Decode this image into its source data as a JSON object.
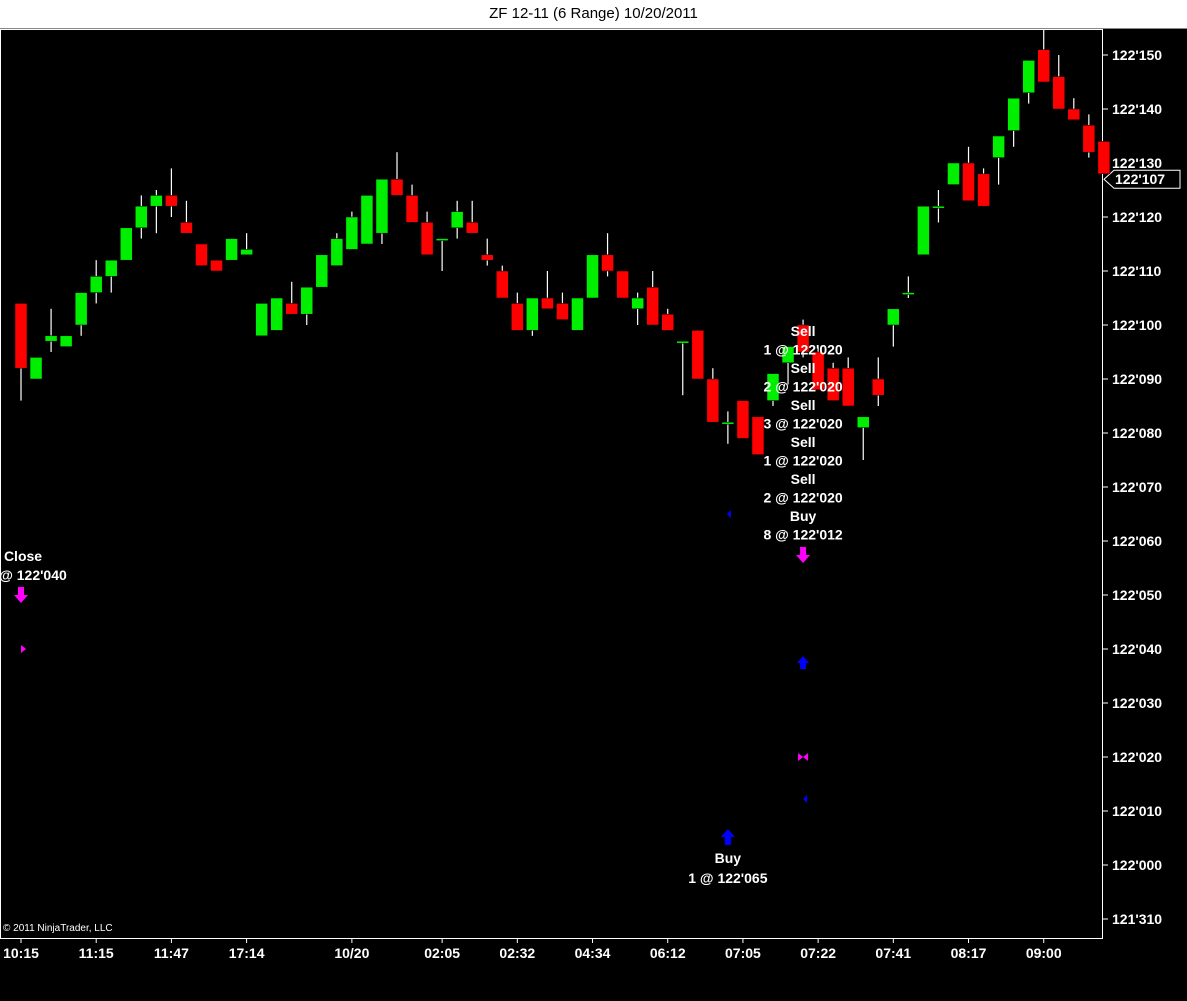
{
  "window": {
    "title": "ZF 12-11 (6 Range)  10/20/2011"
  },
  "copyright": "© 2011 NinjaTrader, LLC",
  "colors": {
    "background": "#000000",
    "up": "#00ee00",
    "down": "#ff0000",
    "wick": "#ffffff",
    "entry_marker": "#0000ff",
    "exit_marker": "#ff00ff"
  },
  "chart_data": {
    "type": "candlestick",
    "instrument": "ZF 12-11",
    "bar_type": "6 Range",
    "date": "10/20/2011",
    "price_unit": "32nds (fractional quote)",
    "y_ticks": [
      "122'150",
      "122'140",
      "122'130",
      "122'120",
      "122'110",
      "122'100",
      "122'090",
      "122'080",
      "122'070",
      "122'060",
      "122'050",
      "122'040",
      "122'030",
      "122'020",
      "122'010",
      "122'000",
      "121'310"
    ],
    "y_range_quarter32": [
      121.31,
      122.15
    ],
    "last_price_label": "122'107",
    "last_price": 122.107,
    "x_ticks": [
      {
        "label": "10:15",
        "bar": 0
      },
      {
        "label": "11:15",
        "bar": 5
      },
      {
        "label": "11:47",
        "bar": 10
      },
      {
        "label": "17:14",
        "bar": 15
      },
      {
        "label": "10/20",
        "bar": 22
      },
      {
        "label": "02:05",
        "bar": 28
      },
      {
        "label": "02:32",
        "bar": 33
      },
      {
        "label": "04:34",
        "bar": 38
      },
      {
        "label": "06:12",
        "bar": 43
      },
      {
        "label": "07:05",
        "bar": 48
      },
      {
        "label": "07:22",
        "bar": 53
      },
      {
        "label": "07:41",
        "bar": 58
      },
      {
        "label": "08:17",
        "bar": 63
      },
      {
        "label": "09:00",
        "bar": 68
      }
    ],
    "ohlc_32nds": [
      [
        3984,
        3984,
        3966,
        3972
      ],
      [
        3970,
        3974,
        3970,
        3974
      ],
      [
        3977,
        3983,
        3975,
        3978
      ],
      [
        3976,
        3978,
        3976,
        3978
      ],
      [
        3980,
        3986,
        3978,
        3986
      ],
      [
        3986,
        3992,
        3984,
        3989
      ],
      [
        3989,
        3992,
        3986,
        3992
      ],
      [
        3992,
        3998,
        3992,
        3998
      ],
      [
        3998,
        4004,
        3996,
        4002
      ],
      [
        4002,
        4005,
        3997,
        4004
      ],
      [
        4004,
        4009,
        4000,
        4002
      ],
      [
        3999,
        4003,
        3997,
        3997
      ],
      [
        3995,
        3995,
        3991,
        3991
      ],
      [
        3992,
        3992,
        3990,
        3990
      ],
      [
        3992,
        3996,
        3992,
        3996
      ],
      [
        3993,
        3997,
        3993,
        3994
      ],
      [
        3978,
        3984,
        3978,
        3984
      ],
      [
        3979,
        3985,
        3979,
        3985
      ],
      [
        3984,
        3988,
        3982,
        3982
      ],
      [
        3982,
        3987,
        3980,
        3987
      ],
      [
        3987,
        3993,
        3987,
        3993
      ],
      [
        3991,
        3997,
        3991,
        3996
      ],
      [
        3994,
        4001,
        3994,
        4000
      ],
      [
        3995,
        4002,
        3995,
        4004
      ],
      [
        3997,
        4007,
        3995,
        4007
      ],
      [
        4007,
        4012,
        4004,
        4004
      ],
      [
        4004,
        4006,
        3999,
        3999
      ],
      [
        3999,
        4001,
        3995,
        3993
      ],
      [
        3996,
        3996,
        3990,
        3996
      ],
      [
        3998,
        4003,
        3996,
        4001
      ],
      [
        3999,
        4003,
        3997,
        3997
      ],
      [
        3993,
        3996,
        3991,
        3992
      ],
      [
        3990,
        3991,
        3985,
        3985
      ],
      [
        3984,
        3986,
        3980,
        3979
      ],
      [
        3979,
        3982,
        3978,
        3985
      ],
      [
        3985,
        3990,
        3983,
        3983
      ],
      [
        3984,
        3986,
        3982,
        3981
      ],
      [
        3979,
        3985,
        3979,
        3985
      ],
      [
        3985,
        3993,
        3985,
        3993
      ],
      [
        3993,
        3997,
        3989,
        3990
      ],
      [
        3990,
        3990,
        3985,
        3985
      ],
      [
        3983,
        3986,
        3980,
        3985
      ],
      [
        3987,
        3990,
        3981,
        3980
      ],
      [
        3982,
        3983,
        3979,
        3979
      ],
      [
        3977,
        3977,
        3967,
        3977
      ],
      [
        3979,
        3979,
        3970,
        3970
      ],
      [
        3970,
        3972,
        3962,
        3962
      ],
      [
        3962,
        3964,
        3958,
        3962
      ],
      [
        3966,
        3966,
        3963,
        3959
      ],
      [
        3963,
        3963,
        3956,
        3956
      ],
      [
        3966,
        3971,
        3965,
        3971
      ],
      [
        3973,
        3976,
        3969,
        3976
      ],
      [
        3980,
        3981,
        3974,
        3975
      ],
      [
        3975,
        3976,
        3968,
        3968
      ],
      [
        3972,
        3973,
        3966,
        3966
      ],
      [
        3972,
        3974,
        3965,
        3965
      ],
      [
        3961,
        3963,
        3955,
        3963
      ],
      [
        3970,
        3974,
        3965,
        3967
      ],
      [
        3980,
        3983,
        3976,
        3983
      ],
      [
        3986,
        3989,
        3985,
        3986
      ],
      [
        3993,
        4002,
        3993,
        4002
      ],
      [
        4002,
        4005,
        3999,
        4002
      ],
      [
        4006,
        4010,
        4006,
        4010
      ],
      [
        4010,
        4013,
        4003,
        4003
      ],
      [
        4008,
        4009,
        4002,
        4002
      ],
      [
        4011,
        4015,
        4006,
        4015
      ],
      [
        4016,
        4022,
        4013,
        4022
      ],
      [
        4023,
        4029,
        4021,
        4029
      ],
      [
        4031,
        4036,
        4025,
        4025
      ],
      [
        4026,
        4030,
        4020,
        4020
      ],
      [
        4020,
        4022,
        4018,
        4018
      ],
      [
        4017,
        4019,
        4011,
        4012
      ],
      [
        4014,
        4014,
        4008,
        4008
      ]
    ],
    "annotations": [
      {
        "type": "exit",
        "label": "Close",
        "sub": "@ 122'040",
        "bar": 0
      },
      {
        "type": "entry",
        "label": "Buy",
        "sub": "1 @ 122'065",
        "bar": 47
      },
      {
        "type": "exit_group",
        "lines": [
          "Sell",
          "1 @ 122'020",
          "Sell",
          "2 @ 122'020",
          "Sell",
          "3 @ 122'020",
          "Sell",
          "1 @ 122'020",
          "Sell",
          "2 @ 122'020",
          "Buy",
          "8 @ 122'012"
        ],
        "bar": 52
      }
    ]
  }
}
